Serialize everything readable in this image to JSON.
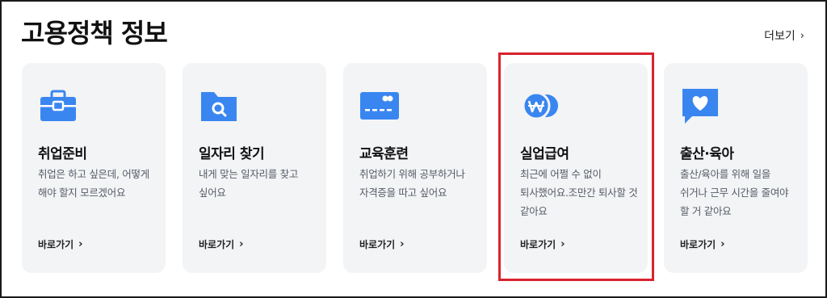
{
  "header": {
    "title": "고용정책 정보",
    "more_label": "더보기"
  },
  "colors": {
    "icon_blue": "#3a86f0",
    "card_bg": "#f3f4f6",
    "highlight": "#d9232e"
  },
  "cards": [
    {
      "icon": "briefcase-icon",
      "title": "취업준비",
      "desc": "취업은 하고 싶은데, 어떻게 해야 할지 모르겠어요",
      "link": "바로가기"
    },
    {
      "icon": "folder-search-icon",
      "title": "일자리 찾기",
      "desc": "내게 맞는 일자리를 찾고 싶어요",
      "link": "바로가기"
    },
    {
      "icon": "credit-card-icon",
      "title": "교육훈련",
      "desc": "취업하기 위해 공부하거나 자격증을 따고 싶어요",
      "link": "바로가기"
    },
    {
      "icon": "won-coin-icon",
      "title": "실업급여",
      "desc": "최근에 어쩔 수 없이 퇴사했어요.조만간 퇴사할 것 같아요",
      "link": "바로가기"
    },
    {
      "icon": "heart-chat-icon",
      "title": "출산·육아",
      "desc": "출산/육아를 위해 일을 쉬거나 근무 시간을 줄여야 할 거 같아요",
      "link": "바로가기"
    }
  ]
}
